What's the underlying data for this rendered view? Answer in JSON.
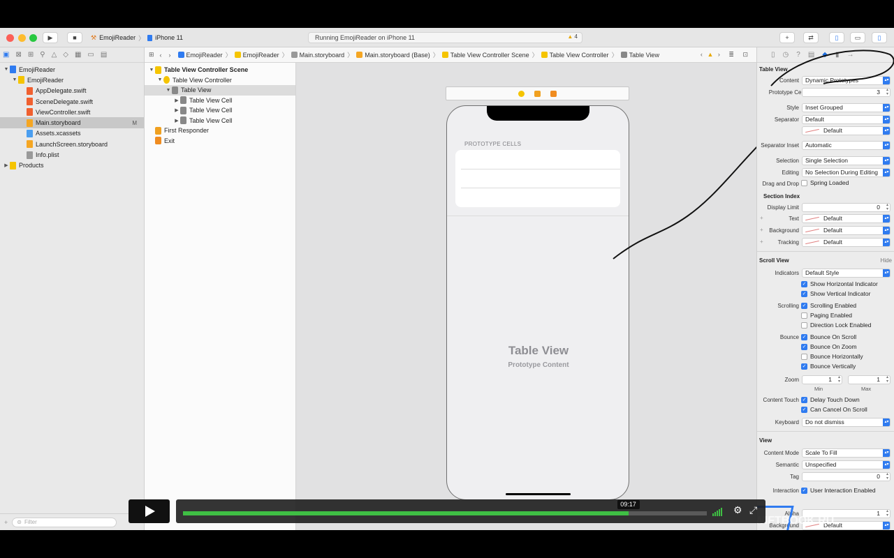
{
  "toolbar": {
    "scheme_app": "EmojiReader",
    "scheme_device": "iPhone 11",
    "status_text": "Running EmojiReader on iPhone 11",
    "warning_count": "4"
  },
  "navigator": {
    "items": [
      {
        "label": "EmojiReader",
        "indent": 0,
        "kind": "project",
        "expanded": true
      },
      {
        "label": "EmojiReader",
        "indent": 1,
        "kind": "folder",
        "expanded": true
      },
      {
        "label": "AppDelegate.swift",
        "indent": 2,
        "kind": "swift"
      },
      {
        "label": "SceneDelegate.swift",
        "indent": 2,
        "kind": "swift"
      },
      {
        "label": "ViewController.swift",
        "indent": 2,
        "kind": "swift"
      },
      {
        "label": "Main.storyboard",
        "indent": 2,
        "kind": "storyboard",
        "selected": true,
        "badge": "M"
      },
      {
        "label": "Assets.xcassets",
        "indent": 2,
        "kind": "assets"
      },
      {
        "label": "LaunchScreen.storyboard",
        "indent": 2,
        "kind": "storyboard"
      },
      {
        "label": "Info.plist",
        "indent": 2,
        "kind": "plist"
      },
      {
        "label": "Products",
        "indent": 0,
        "kind": "folder",
        "expanded": false
      }
    ],
    "filter_placeholder": "Filter"
  },
  "jumpbar": {
    "crumbs": [
      "EmojiReader",
      "EmojiReader",
      "Main.storyboard",
      "Main.storyboard (Base)",
      "Table View Controller Scene",
      "Table View Controller",
      "Table View"
    ]
  },
  "outline": {
    "items": [
      {
        "label": "Table View Controller Scene",
        "indent": 0,
        "bold": true
      },
      {
        "label": "Table View Controller",
        "indent": 1
      },
      {
        "label": "Table View",
        "indent": 2,
        "selected": true
      },
      {
        "label": "Table View Cell",
        "indent": 3
      },
      {
        "label": "Table View Cell",
        "indent": 3
      },
      {
        "label": "Table View Cell",
        "indent": 3
      },
      {
        "label": "First Responder",
        "indent": 0
      },
      {
        "label": "Exit",
        "indent": 0
      }
    ]
  },
  "canvas": {
    "prototype_cells_label": "PROTOTYPE CELLS",
    "placeholder_title": "Table View",
    "placeholder_subtitle": "Prototype Content"
  },
  "inspector": {
    "table_view_title": "Table View",
    "content_label": "Content",
    "content_value": "Dynamic Prototypes",
    "prototype_cells_label": "Prototype Cells",
    "prototype_cells_value": "3",
    "style_label": "Style",
    "style_value": "Inset Grouped",
    "separator_label": "Separator",
    "separator_value": "Default",
    "separator_color_value": "Default",
    "separator_inset_label": "Separator Inset",
    "separator_inset_value": "Automatic",
    "selection_label": "Selection",
    "selection_value": "Single Selection",
    "editing_label": "Editing",
    "editing_value": "No Selection During Editing",
    "drag_drop_label": "Drag and Drop",
    "spring_loaded": "Spring Loaded",
    "section_index_title": "Section Index",
    "display_limit_label": "Display Limit",
    "display_limit_value": "0",
    "text_label": "Text",
    "text_value": "Default",
    "background_label": "Background",
    "background_value": "Default",
    "tracking_label": "Tracking",
    "tracking_value": "Default",
    "scroll_view_title": "Scroll View",
    "hide_label": "Hide",
    "indicators_label": "Indicators",
    "indicators_value": "Default Style",
    "show_h": "Show Horizontal Indicator",
    "show_v": "Show Vertical Indicator",
    "scrolling_label": "Scrolling",
    "scrolling_enabled": "Scrolling Enabled",
    "paging_enabled": "Paging Enabled",
    "direction_lock": "Direction Lock Enabled",
    "bounce_label": "Bounce",
    "bounce_on_scroll": "Bounce On Scroll",
    "bounce_on_zoom": "Bounce On Zoom",
    "bounce_h": "Bounce Horizontally",
    "bounce_v": "Bounce Vertically",
    "zoom_label": "Zoom",
    "zoom_min": "1",
    "zoom_max": "1",
    "min_label": "Min",
    "max_label": "Max",
    "content_touch_label": "Content Touch",
    "delay_touch": "Delay Touch Down",
    "can_cancel": "Can Cancel On Scroll",
    "keyboard_label": "Keyboard",
    "keyboard_value": "Do not dismiss",
    "view_title": "View",
    "content_mode_label": "Content Mode",
    "content_mode_value": "Scale To Fill",
    "semantic_label": "Semantic",
    "semantic_value": "Unspecified",
    "tag_label": "Tag",
    "tag_value": "0",
    "interaction_label": "Interaction",
    "user_interaction": "User Interaction Enabled",
    "alpha_label": "Alpha",
    "alpha_value": "1",
    "background2_label": "Background",
    "background2_value": "Default"
  },
  "player": {
    "time": "09:17",
    "progress": 0.85,
    "accent": "#3fbf44"
  },
  "watermark": "SWIFTBOOK.RU"
}
